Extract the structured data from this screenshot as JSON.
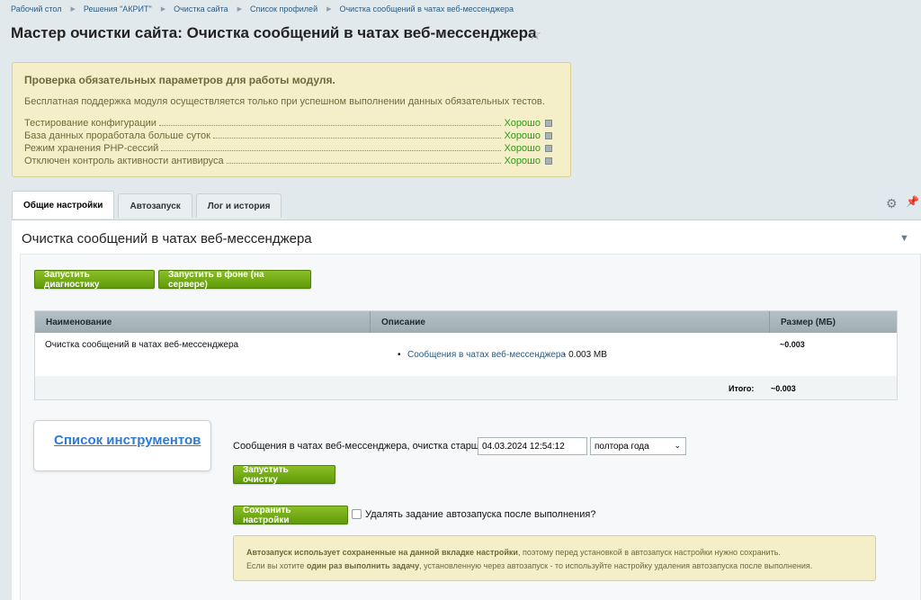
{
  "breadcrumb": [
    "Рабочий стол",
    "Решения \"АКРИТ\"",
    "Очистка сайта",
    "Список профилей",
    "Очистка сообщений в чатах веб-мессенджера"
  ],
  "page_title": "Мастер очистки сайта: Очистка сообщений в чатах веб-мессенджера",
  "checks": {
    "title": "Проверка обязательных параметров для работы модуля.",
    "description": "Бесплатная поддержка модуля осуществляется только при успешном выполнении данных обязательных тестов.",
    "items": [
      {
        "label": "Тестирование конфигурации",
        "result": "Хорошо"
      },
      {
        "label": "База данных проработала больше суток",
        "result": "Хорошо"
      },
      {
        "label": "Режим хранения PHP-сессий",
        "result": "Хорошо"
      },
      {
        "label": "Отключен контроль активности антивируса",
        "result": "Хорошо"
      }
    ]
  },
  "tabs": [
    "Общие настройки",
    "Автозапуск",
    "Лог и история"
  ],
  "section_title": "Очистка сообщений в чатах веб-мессенджера",
  "buttons": {
    "diagnostics": "Запустить диагностику",
    "background": "Запустить в фоне (на сервере)",
    "run_cleanup": "Запустить очистку",
    "save_settings": "Сохранить настройки"
  },
  "table": {
    "headers": [
      "Наименование",
      "Описание",
      "Размер (МБ)"
    ],
    "rows": [
      {
        "name": "Очистка сообщений в чатах веб-мессенджера",
        "desc_link": "Сообщения в чатах веб-мессенджера",
        "desc_suffix": " - 0.003 MB",
        "size": "~0.003"
      }
    ],
    "total_label": "Итого:",
    "total_value": "~0.003"
  },
  "tools_link": "Список инструментов",
  "cleanup": {
    "label": "Сообщения в чатах веб-мессенджера, очистка старше:",
    "date_value": "04.03.2024 12:54:12",
    "period_value": "полтора года"
  },
  "checkbox_label": "Удалять задание автозапуска после выполнения?",
  "note": {
    "line1_bold": "Автозапуск использует сохраненные на данной вкладке настройки",
    "line1_rest": ", поэтому перед установкой в автозапуск настройки нужно сохранить.",
    "line2_start": "Если вы хотите ",
    "line2_bold": "один раз выполнить задачу",
    "line2_rest": ", установленную через автозапуск - то используйте настройку удаления автозапуска после выполнения."
  },
  "icons": {
    "star": "star-icon",
    "gear": "gear-icon",
    "pin": "pin-icon",
    "collapse": "chevron-down-icon",
    "help": "question-icon"
  },
  "colors": {
    "accent_green": "#6aa614",
    "link_blue": "#2c5b82",
    "ok_green": "#2d9b12",
    "warning_bg": "#f4efc8"
  }
}
